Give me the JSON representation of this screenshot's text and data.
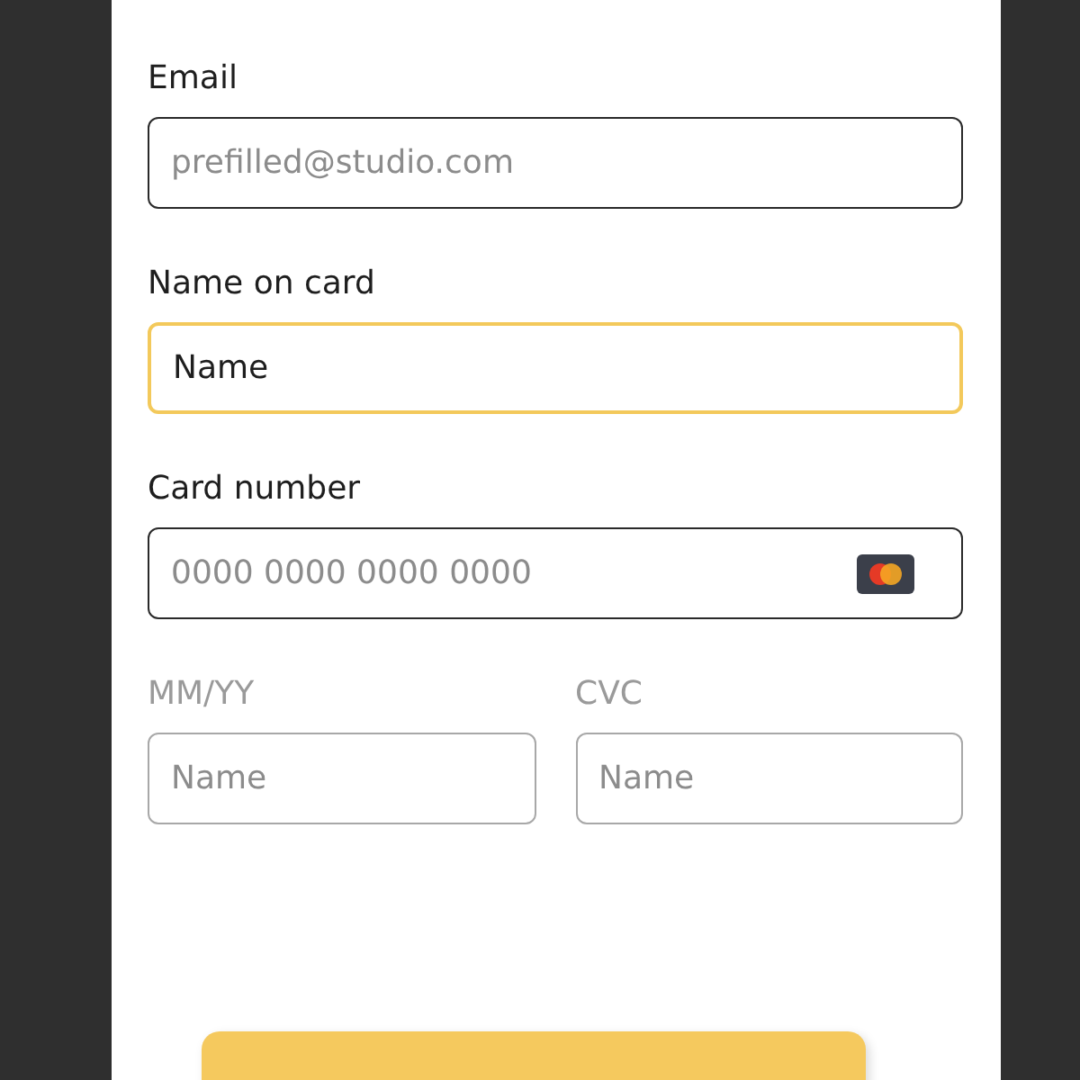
{
  "fields": [
    {
      "label": "Email",
      "placeholder": "prefilled@studio.com",
      "focused": false,
      "disabled": false,
      "kind": "text"
    },
    {
      "label": "Name on card",
      "value": "Name",
      "focused": true,
      "disabled": false,
      "kind": "text"
    },
    {
      "label": "Card number",
      "placeholder": "0000 0000 0000 0000",
      "focused": false,
      "disabled": false,
      "kind": "card"
    }
  ],
  "split_fields": [
    {
      "label": "MM/YY",
      "placeholder": "Name",
      "focused": false,
      "disabled": true
    },
    {
      "label": "CVC",
      "placeholder": "Name",
      "focused": false,
      "disabled": true
    }
  ]
}
